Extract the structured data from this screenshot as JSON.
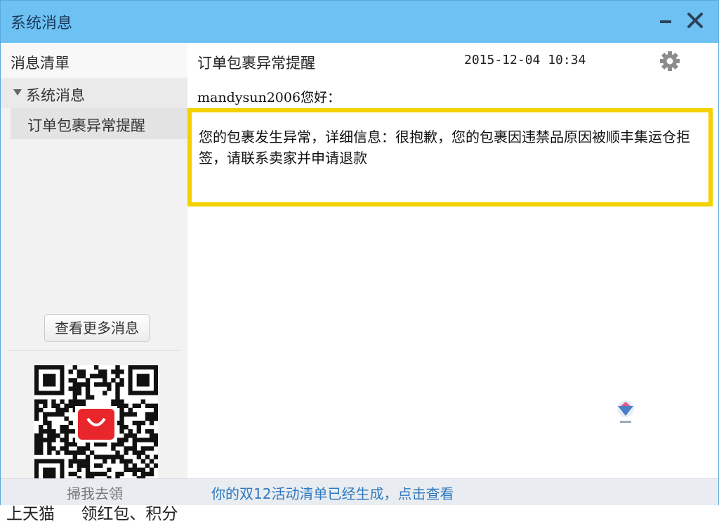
{
  "window": {
    "title": "系统消息",
    "minimize_icon": "minimize-icon",
    "close_icon": "close-icon"
  },
  "sidebar": {
    "header": "消息清單",
    "group": {
      "label": "系统消息",
      "expanded": true
    },
    "items": [
      {
        "label": "订单包裹异常提醒",
        "selected": true
      }
    ],
    "more_button": "查看更多消息",
    "promo": {
      "left": "上天猫",
      "right": "领红包、积分"
    },
    "scan_text": "掃我去領"
  },
  "message": {
    "title": "订单包裹异常提醒",
    "timestamp": "2015-12-04 10:34",
    "greeting_user": "mandysun2006",
    "greeting_suffix": "您好：",
    "body": "您的包裹发生异常，详细信息：很抱歉，您的包裹因违禁品原因被顺丰集运仓拒签，请联系卖家并申请退款"
  },
  "footer": {
    "notice": "你的双12活动清单已经生成，点击查看"
  },
  "colors": {
    "titlebar": "#6ec2f3",
    "highlight_border": "#f3d000",
    "link": "#2e78bf",
    "tmall_red": "#e8262c"
  }
}
